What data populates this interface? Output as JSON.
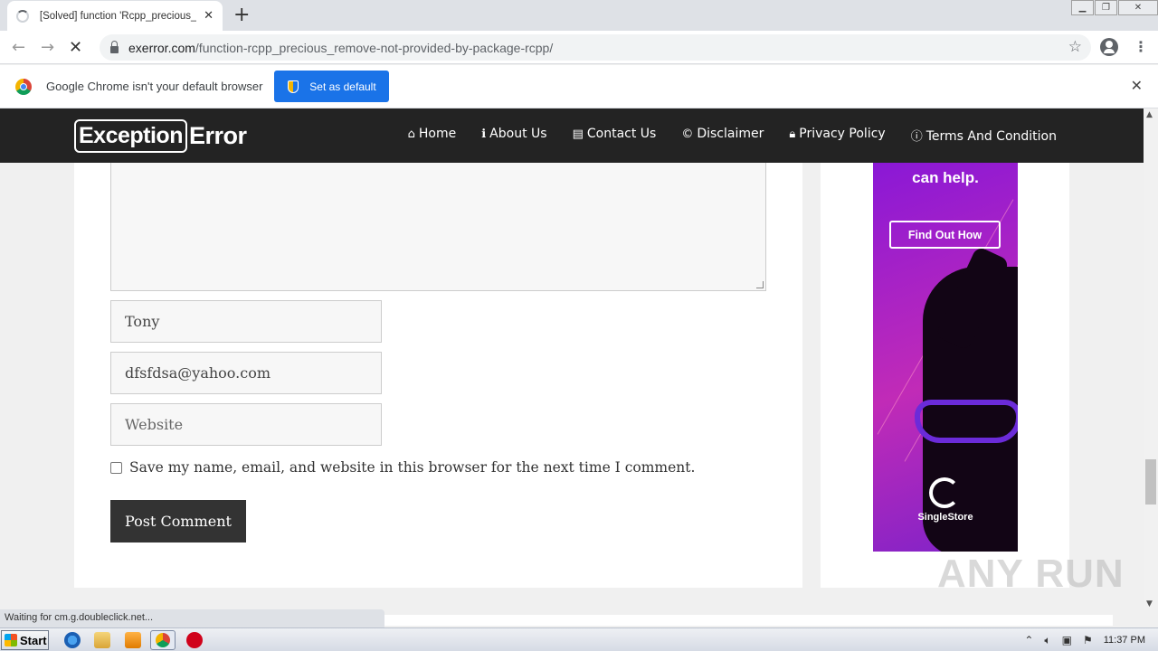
{
  "browser": {
    "tab_title": "[Solved] function 'Rcpp_precious_remove' not provided by package 'Rcpp'",
    "url_host": "exerror.com",
    "url_path": "/function-rcpp_precious_remove-not-provided-by-package-rcpp/",
    "infobar_text": "Google Chrome isn't your default browser",
    "set_default_label": "Set as default",
    "status_text": "Waiting for cm.g.doubleclick.net..."
  },
  "site": {
    "logo_box": "Exception",
    "logo_rest": "Error",
    "nav": [
      {
        "icon": "home-icon",
        "label": "Home"
      },
      {
        "icon": "info-icon",
        "label": "About Us"
      },
      {
        "icon": "contact-card-icon",
        "label": "Contact Us"
      },
      {
        "icon": "copyright-icon",
        "label": "Disclaimer"
      },
      {
        "icon": "lock-icon",
        "label": "Privacy Policy"
      },
      {
        "icon": "info-circle-icon",
        "label": "Terms And Condition"
      }
    ]
  },
  "form": {
    "name_value": "Tony",
    "email_value": "dfsfdsa@yahoo.com",
    "website_placeholder": "Website",
    "save_label": "Save my name, email, and website in this browser for the next time I comment.",
    "post_label": "Post Comment"
  },
  "ad": {
    "headline": "can help.",
    "button": "Find Out How",
    "brand": "SingleStore"
  },
  "taskbar": {
    "start_label": "Start",
    "clock": "11:37 PM"
  },
  "watermark": "ANY RUN"
}
